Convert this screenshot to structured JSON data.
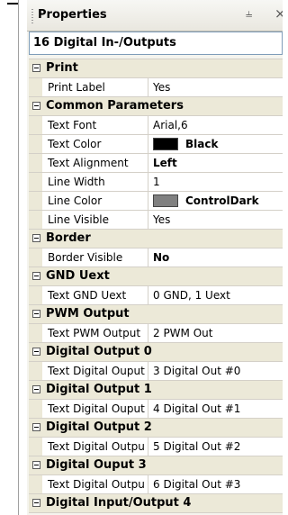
{
  "panel": {
    "title": "Properties",
    "pin_glyph": "❤",
    "close_glyph": "×"
  },
  "object_name": "16 Digital In-/Outputs",
  "categories": [
    {
      "label": "Print",
      "rows": [
        {
          "name": "Print Label",
          "value": "Yes"
        }
      ]
    },
    {
      "label": "Common Parameters",
      "rows": [
        {
          "name": "Text Font",
          "value": "Arial,6"
        },
        {
          "name": "Text Color",
          "value": "Black",
          "bold": true,
          "swatch": "#000000"
        },
        {
          "name": "Text Alignment",
          "value": "Left",
          "bold": true
        },
        {
          "name": "Line Width",
          "value": "1"
        },
        {
          "name": "Line Color",
          "value": "ControlDark",
          "bold": true,
          "swatch": "#808080"
        },
        {
          "name": "Line Visible",
          "value": "Yes"
        }
      ]
    },
    {
      "label": "Border",
      "rows": [
        {
          "name": "Border Visible",
          "value": "No",
          "bold": true
        }
      ]
    },
    {
      "label": "GND Uext",
      "rows": [
        {
          "name": "Text GND Uext",
          "value": "0 GND, 1 Uext"
        }
      ]
    },
    {
      "label": "PWM Output",
      "rows": [
        {
          "name": "Text PWM Output",
          "value": "2 PWM Out"
        }
      ]
    },
    {
      "label": "Digital Output 0",
      "rows": [
        {
          "name": "Text Digital Ouput",
          "value": "3 Digital Out #0"
        }
      ]
    },
    {
      "label": "Digital Output 1",
      "rows": [
        {
          "name": "Text Digital Ouput",
          "value": "4 Digital Out #1"
        }
      ]
    },
    {
      "label": "Digital Output 2",
      "rows": [
        {
          "name": "Text Digital Outpu",
          "value": "5 Digital Out #2"
        }
      ]
    },
    {
      "label": "Digital Ouput 3",
      "rows": [
        {
          "name": "Text Digital Outpu",
          "value": "6 Digital Out #3"
        }
      ]
    },
    {
      "label": "Digital Input/Output 4",
      "rows": []
    }
  ]
}
